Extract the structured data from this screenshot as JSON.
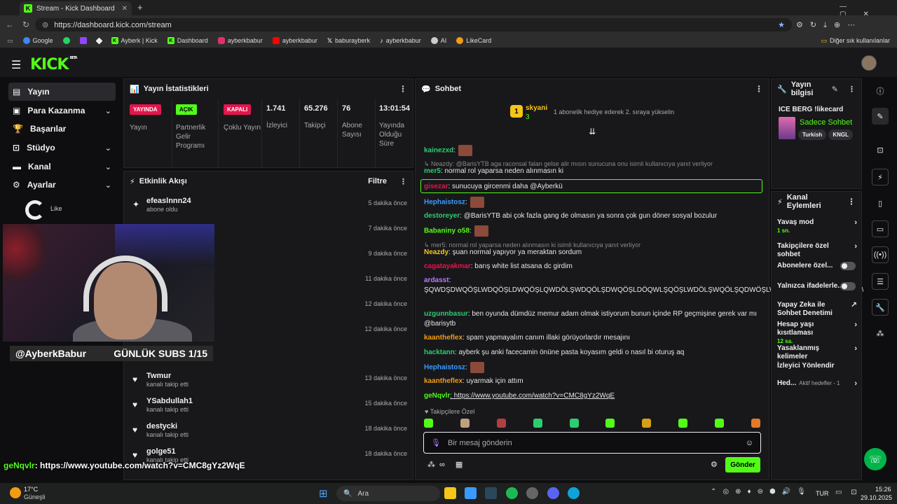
{
  "browser": {
    "tab_title": "Stream - Kick Dashboard",
    "url": "https://dashboard.kick.com/stream",
    "bookmarks": [
      "Google",
      "Ayberk | Kick",
      "Dashboard",
      "ayberkbabur",
      "ayberkbabur",
      "baburayberk",
      "ayberkbabur",
      "AI",
      "LikeCard"
    ],
    "other_bookmarks": "Diğer sık kullanılanlar"
  },
  "header": {
    "logo": "KICK",
    "logo_badge": "BETA"
  },
  "sidebar": {
    "items": [
      {
        "label": "Yayın",
        "icon": "broadcast-icon"
      },
      {
        "label": "Para Kazanma",
        "icon": "money-icon"
      },
      {
        "label": "Başarılar",
        "icon": "trophy-icon"
      },
      {
        "label": "Stüdyo",
        "icon": "studio-icon"
      },
      {
        "label": "Kanal",
        "icon": "channel-icon"
      },
      {
        "label": "Ayarlar",
        "icon": "settings-icon"
      }
    ],
    "like_label": "Like"
  },
  "stream_overlay": {
    "channel_name": "@AyberkBabur",
    "subs_goal": "GÜNLÜK SUBS 1/15",
    "chat_user": "geNqvlr",
    "chat_msg": ": https://www.youtube.com/watch?v=CMC8gYz2WqE"
  },
  "stats": {
    "title": "Yayın İstatistikleri",
    "items": [
      {
        "badge": "YAYINDA",
        "label": "Yayın"
      },
      {
        "badge": "AÇIK",
        "label": "Partnerlik Gelir Programı"
      },
      {
        "badge": "KAPALI",
        "label": "Çoklu Yayın"
      },
      {
        "value": "1.741",
        "label": "İzleyici"
      },
      {
        "value": "65.276",
        "label": "Takipçi"
      },
      {
        "value": "76",
        "label": "Abone Sayısı"
      },
      {
        "value": "13:01:54",
        "label": "Yayında Olduğu Süre"
      }
    ]
  },
  "activity": {
    "title": "Etkinlik Akışı",
    "filter_label": "Filtre",
    "rows": [
      {
        "name": "efeaslnnn24",
        "sub": "abone oldu",
        "time": "5 dakika önce"
      },
      {
        "name": "",
        "sub": "",
        "time": "7 dakika önce"
      },
      {
        "name": "",
        "sub": "",
        "time": "9 dakika önce"
      },
      {
        "name": "",
        "sub": "",
        "time": "11 dakika önce"
      },
      {
        "name": "",
        "sub": "",
        "time": "12 dakika önce"
      },
      {
        "name": "",
        "sub": "",
        "time": "12 dakika önce"
      },
      {
        "name": "Twmur",
        "sub": "kanalı takip etti",
        "time": "13 dakika önce"
      },
      {
        "name": "YSabdullah1",
        "sub": "kanalı takip etti",
        "time": "15 dakika önce"
      },
      {
        "name": "destycki",
        "sub": "kanalı takip etti",
        "time": "18 dakika önce"
      },
      {
        "name": "golge51",
        "sub": "kanalı takip etti",
        "time": "18 dakika önce"
      }
    ]
  },
  "chat": {
    "title": "Sohbet",
    "pinned_user": "skyani",
    "pinned_count": "3",
    "pinned_rank": "1",
    "pinned_note": "1 abonelik hediye ederek 2. sıraya yükselin",
    "messages": [
      {
        "user": "kainezxd",
        "text": ":",
        "color": "#2ecc71"
      },
      {
        "reply": "Neazdy: @BarisYTB aga raconsal falan gelse alir mısın sunucuna onu isimli kullanıcıya yanıt verliyor"
      },
      {
        "user": "mer5",
        "text": ": normal rol yaparsa neden alınmasın ki",
        "color": "#2ecc71"
      },
      {
        "user": "gisezar",
        "text": ": sunucuya gircenmi daha @Ayberkü",
        "color": "#e4154c"
      },
      {
        "user": "Hephaistosz",
        "text": ":",
        "color": "#3a9bff"
      },
      {
        "user": "destoreyer",
        "text": ": @BarisYTB abi çok fazla gang de olmasın ya sonra çok gun döner sosyal bozulur",
        "color": "#2ecc71"
      },
      {
        "user": "Babaniny o58",
        "text": ":",
        "color": "#53fc18"
      },
      {
        "reply": "mer5: normal rol yaparsa neden alınmasın ki isimli kullanıcıya yanıt verliyor"
      },
      {
        "user": "Neazdy",
        "text": ": şuan normal yapıyor ya meraktan sordum",
        "color": "#f5c518"
      },
      {
        "user": "cagatayakmar",
        "text": ": barış white list atsana dc girdim",
        "color": "#e4154c"
      },
      {
        "user": "ardasst",
        "text": ":",
        "color": "#b57cff"
      },
      {
        "text": "ŞQWDŞDWQÖŞLWDQÖŞLDWQÖŞLQWDÖLŞWDQÖLŞDWQÖŞLDÖQWLŞQÖŞLWDÖLŞWQÖLŞQDWÖŞLWDQÖŞLWQDÖŞLQWDQDWŞ"
      },
      {
        "user": "uzgunnbasur",
        "text": ": ben oyunda dümdüz memur adam olmak istiyorum bunun içinde RP geçmişine gerek var mı @barisytb",
        "color": "#2ecc71"
      },
      {
        "user": "kaantheflex",
        "text": ": spam yapmayalım canım illaki görüyorlardır mesajını",
        "color": "#f39c12"
      },
      {
        "user": "hacktann",
        "text": ": ayberk şu anki facecamin önüne pasta koyasım geldi o nasıl bi oturuş aq",
        "color": "#2ecc71"
      },
      {
        "user": "Hephaistosz",
        "text": ":",
        "color": "#3a9bff"
      },
      {
        "user": "kaantheflex",
        "text": ": uyarmak için attım",
        "color": "#f39c12"
      },
      {
        "user": "geNqvlr",
        "text": ": https://www.youtube.com/watch?v=CMC8gYz2WqE",
        "color": "#53fc18"
      }
    ],
    "emote_label": "Takipçilere Özel",
    "input_placeholder": "Bir mesaj gönderin",
    "send_label": "Gönder"
  },
  "stream_info": {
    "title": "Yayın bilgisi",
    "stream_title": "ICE BERG !likecard",
    "category": "Sadece Sohbet",
    "tags": [
      "Turkish",
      "KNGL"
    ]
  },
  "channel_actions": {
    "title": "Kanal Eylemleri",
    "items": [
      {
        "label": "Yavaş mod",
        "sub": "1 sn.",
        "type": "arrow"
      },
      {
        "label": "Takipçilere özel sohbet",
        "sub": "",
        "type": "arrow"
      },
      {
        "label": "Abonelere özel...",
        "sub": "",
        "type": "toggle"
      },
      {
        "label": "Yalnızca ifadelerle...",
        "sub": "",
        "type": "toggle"
      },
      {
        "label": "Yapay Zeka ile Sohbet Denetimi",
        "sub": "",
        "type": "link"
      },
      {
        "label": "Hesap yaşı kısıtlaması",
        "sub": "12 sa.",
        "type": "arrow"
      },
      {
        "label": "Yasaklanmış kelimeler",
        "sub": "",
        "type": "arrow"
      },
      {
        "label": "İzleyici Yönlendir",
        "sub": "",
        "type": "none"
      },
      {
        "label": "Hed...",
        "sub": "Aktif hedefler - 1",
        "type": "arrow"
      }
    ]
  },
  "taskbar": {
    "weather_temp": "17°C",
    "weather_desc": "Güneşli",
    "search_placeholder": "Ara",
    "lang": "TUR",
    "time": "15:26",
    "date": "29.10.2025"
  },
  "colors": {
    "accent": "#53fc18",
    "live_red": "#e4154c",
    "panel_bg": "#18181b"
  }
}
